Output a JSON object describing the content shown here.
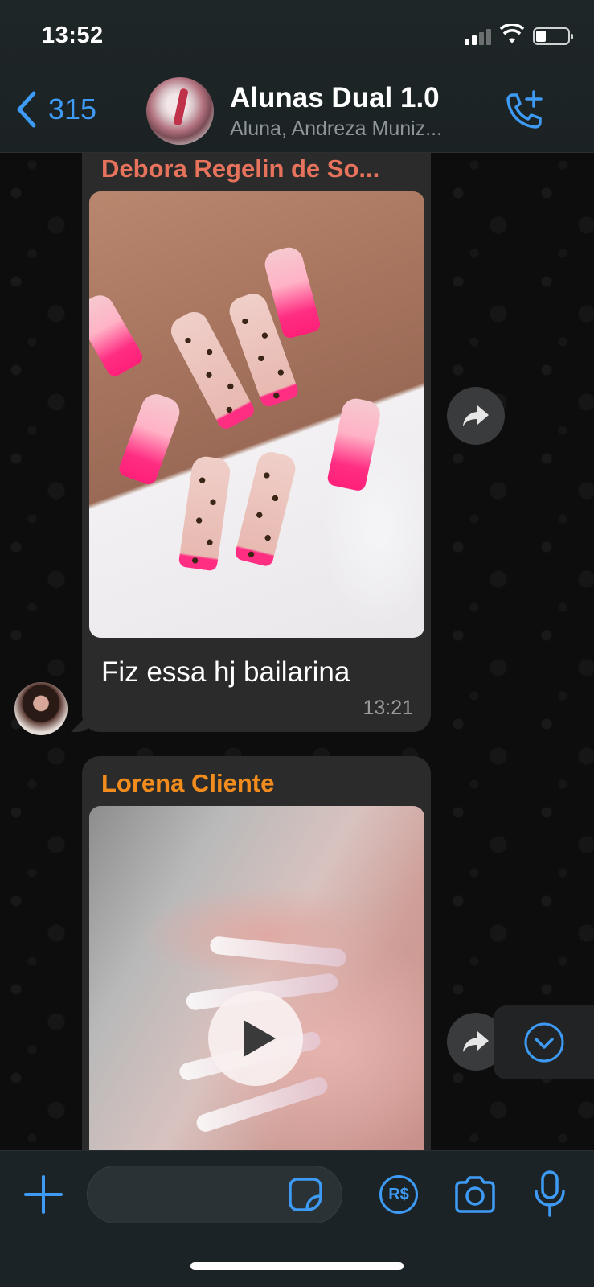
{
  "status_bar": {
    "time": "13:52"
  },
  "header": {
    "back_count": "315",
    "group_name": "Alunas Dual 1.0",
    "members_preview": "Aluna, Andreza Muniz..."
  },
  "messages": [
    {
      "sender": "Debora Regelin de So...",
      "sender_color": "#e8735d",
      "type": "image",
      "caption": "Fiz essa hj bailarina",
      "time": "13:21"
    },
    {
      "sender": "Lorena Cliente",
      "sender_color": "#f28c1c",
      "type": "video"
    }
  ],
  "composer": {
    "input_value": "",
    "pay_label": "R$"
  },
  "colors": {
    "accent": "#3e9bf5",
    "bubble": "#2b2b2b",
    "header": "#1f2628"
  }
}
